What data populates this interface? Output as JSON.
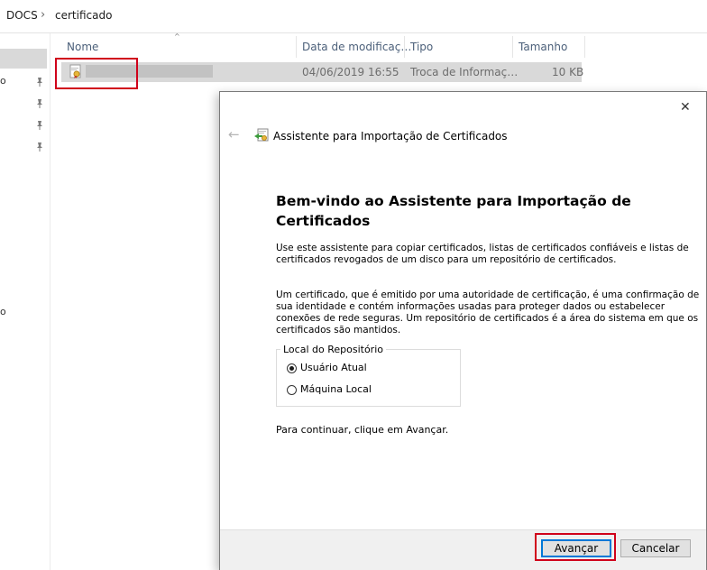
{
  "breadcrumb": {
    "folder": "DOCS",
    "separator": "›",
    "current": "certificado"
  },
  "nav": {
    "fragment_a": "o",
    "fragment_b": "o"
  },
  "columns": {
    "name": "Nome",
    "modified": "Data de modificaç…",
    "type": "Tipo",
    "size": "Tamanho"
  },
  "file": {
    "modified": "04/06/2019 16:55",
    "type": "Troca de Informaç…",
    "size": "10 KB"
  },
  "dialog": {
    "back_glyph": "←",
    "close_glyph": "✕",
    "title": "Assistente para Importação de Certificados",
    "heading": "Bem-vindo ao Assistente para Importação de Certificados",
    "intro": "Use este assistente para copiar certificados, listas de certificados confiáveis e listas de certificados revogados de um disco para um repositório de certificados.",
    "explanation": "Um certificado, que é emitido por uma autoridade de certificação, é uma confirmação de sua identidade e contém informações usadas para proteger dados ou estabelecer conexões de rede seguras. Um repositório de certificados é a área do sistema em que os certificados são mantidos.",
    "store_group_label": "Local do Repositório",
    "options": [
      {
        "label": "Usuário Atual",
        "selected": true
      },
      {
        "label": "Máquina Local",
        "selected": false
      }
    ],
    "continue_text": "Para continuar, clique em Avançar.",
    "next_button": "Avançar",
    "cancel_button": "Cancelar"
  },
  "colors": {
    "highlight": "#d0021b",
    "default_button": "#0078d7",
    "selection": "#d9d9d9"
  }
}
